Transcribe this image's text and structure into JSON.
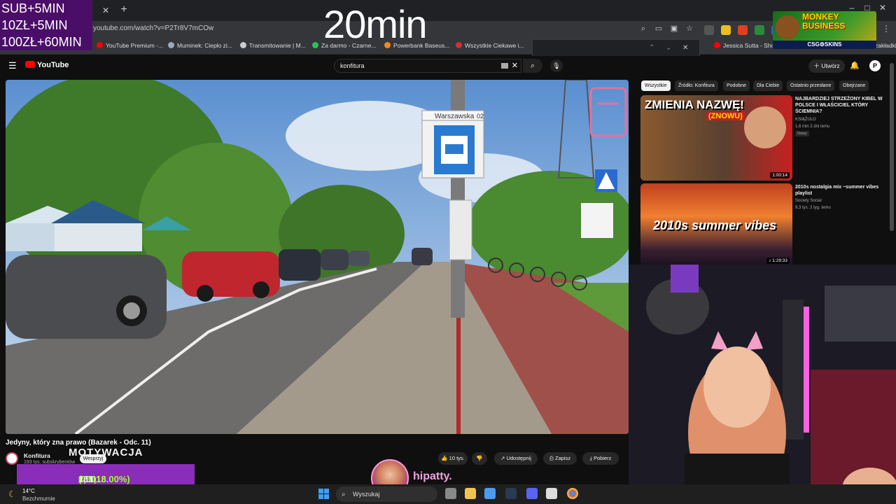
{
  "overlay": {
    "sub_goals": [
      "SUB+5MIN",
      "10ZŁ+5MIN",
      "100ZŁ+60MIN"
    ],
    "timer": "20min",
    "sponsor": {
      "title": "MONKEY BUSINESS",
      "footer": "CSG⚙SKINS"
    },
    "donation": {
      "amount": "261,18 zł",
      "sep": "z",
      "goal": "1,00 zł",
      "percent": "(26118.00%)"
    },
    "motto": "MOTYWACJA",
    "streamer_name": "hipatty."
  },
  "browser": {
    "url": "youtube.com/watch?v=P2Tr8V7mCOw",
    "bookmarks": [
      {
        "label": "YouTube Premium -...",
        "color": "#ff0000"
      },
      {
        "label": "Muminek: Ciepło zi...",
        "color": "#9ab"
      },
      {
        "label": "Transmitowanie | M...",
        "color": "#ccc"
      },
      {
        "label": "Za darmo - Czarne...",
        "color": "#2fbf5a"
      },
      {
        "label": "Powerbank Baseus...",
        "color": "#f08a1a"
      },
      {
        "label": "Wszystkie Ciekawe i...",
        "color": "#d03030"
      },
      {
        "label": "Jessica Sutta - Show",
        "color": "#ff0000"
      },
      {
        "label": "zakładki",
        "color": "#ccc"
      }
    ]
  },
  "youtube": {
    "search_value": "konfitura",
    "create_label": "Utwórz",
    "video": {
      "title": "Jedyny, który zna prawo (Bazarek - Odc. 11)",
      "channel": "Konfitura",
      "subs": "193 tys. subskrybentów",
      "join_label": "Wesprzyj",
      "likes": "10 tys.",
      "share": "Udostępnij",
      "save": "Zapisz",
      "download": "Pobierz",
      "sign_street": "Warszawska",
      "sign_no": "02"
    },
    "chips": [
      "Wszystkie",
      "Źródło: Konfitura",
      "Podobne",
      "Dla Ciebie",
      "Ostatnio przesłane",
      "Obejrzane"
    ],
    "recommendations": [
      {
        "title": "NAJBARDZIEJ STRZEŻONY KIBEL W POLSCE I WŁAŚCICIEL KTÓRY ŚCIEMNIA?",
        "channel": "KSIĄŻULO",
        "meta": "1,6 mln  2 dni temu",
        "badge": "Nowy",
        "duration": "1:00:14",
        "thumb_text": "ZMIENIA NAZWĘ!",
        "thumb_sub": "(ZNOWU)"
      },
      {
        "title": "2010s nostalgia mix ~summer vibes playlist",
        "channel": "Society Social",
        "meta": "9,3 tys.  2 tyg. temu",
        "duration": "♪ 1:29:33",
        "thumb_text": "2010s summer vibes"
      }
    ]
  },
  "taskbar": {
    "temp": "14°C",
    "weather": "Bezchmurnie",
    "search_placeholder": "Wyszukaj"
  }
}
